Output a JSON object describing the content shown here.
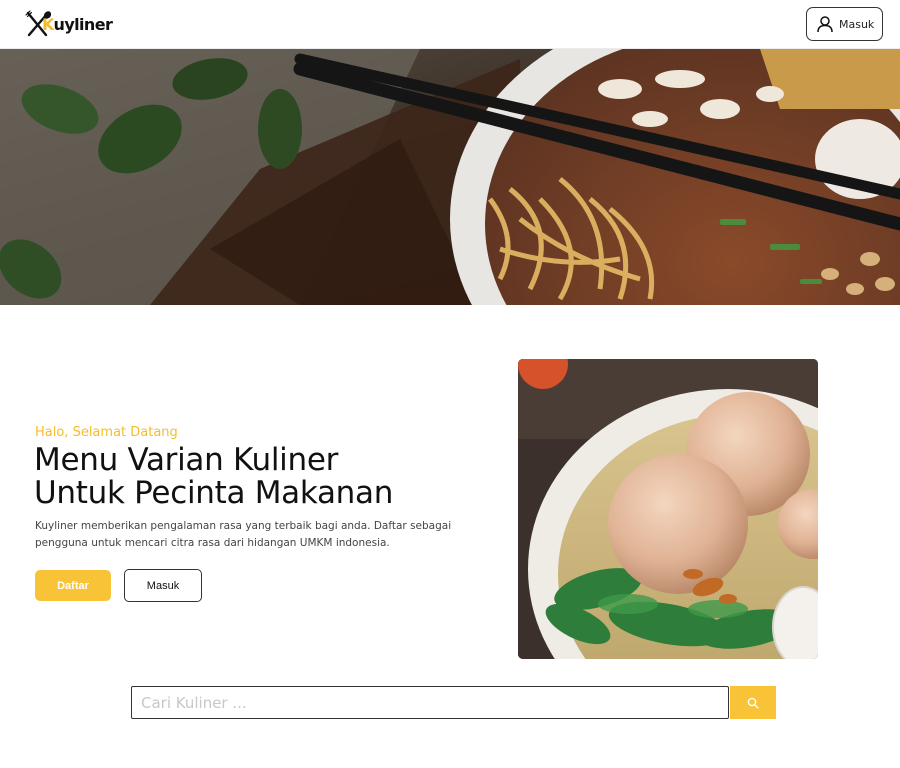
{
  "brand": {
    "name_prefix": "K",
    "name_rest": "uyliner",
    "accent_color": "#f8c336",
    "logo_icon": "utensils-icon"
  },
  "header": {
    "login_label": "Masuk",
    "login_icon": "user-icon"
  },
  "banner": {
    "image": "noodle-bowl-chopsticks-photo"
  },
  "intro": {
    "greeting": "Halo, Selamat Datang",
    "headline_line1": "Menu Varian Kuliner",
    "headline_line2": "Untuk Pecinta Makanan",
    "description": "Kuyliner memberikan pengalaman rasa yang terbaik bagi anda. Daftar sebagai pengguna untuk mencari citra rasa dari hidangan UMKM indonesia.",
    "register_label": "Daftar",
    "login_label": "Masuk",
    "photo": "meatball-soup-photo"
  },
  "search": {
    "placeholder": "Cari Kuliner ...",
    "value": "",
    "button_icon": "search-icon"
  }
}
